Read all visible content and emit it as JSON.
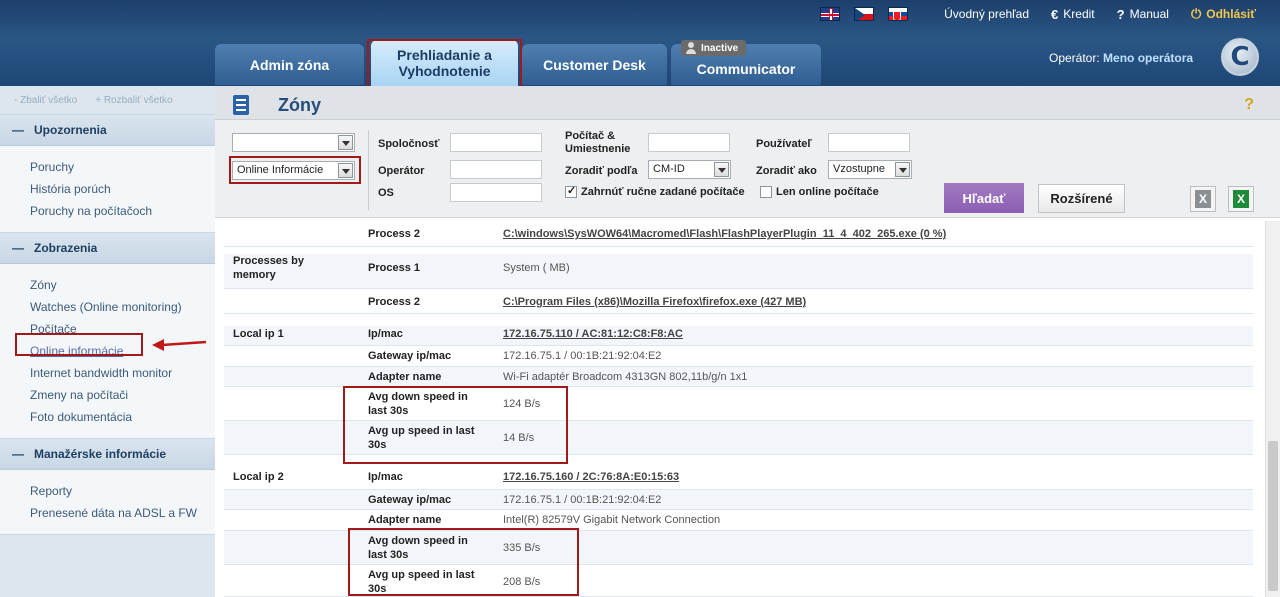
{
  "header": {
    "languages": [
      "en",
      "cz",
      "sk"
    ],
    "links": {
      "overview": "Úvodný prehľad",
      "credit": "Kredit",
      "manual": "Manual",
      "logout": "Odhlásiť"
    },
    "icons": {
      "credit": "euro-icon",
      "manual": "question-icon",
      "logout": "power-icon"
    },
    "tabs": [
      {
        "label": "Admin zóna"
      },
      {
        "label": "Prehliadanie a Vyhodnotenie",
        "active": true
      },
      {
        "label": "Customer Desk"
      },
      {
        "label": "Communicator",
        "badge": "Inactive"
      }
    ],
    "operator_label": "Operátor:",
    "operator_name": "Meno operátora",
    "logo_letter": "C"
  },
  "sidebar": {
    "collapse_all": "- Zbaliť všetko",
    "expand_all": "+ Rozbaliť všetko",
    "sections": [
      {
        "title": "Upozornenia",
        "items": [
          "Poruchy",
          "História porúch",
          "Poruchy na počítačoch"
        ]
      },
      {
        "title": "Zobrazenia",
        "items": [
          "Zóny",
          "Watches (Online monitoring)",
          "Počítače",
          "Online informácie",
          "Internet bandwidth monitor",
          "Zmeny na počítači",
          "Foto dokumentácia"
        ]
      },
      {
        "title": "Manažérske informácie",
        "items": [
          "Reporty",
          "Prenesené dáta na ADSL a FW"
        ]
      }
    ],
    "current_item": "Online informácie"
  },
  "main": {
    "title": "Zóny",
    "help": "?"
  },
  "filter": {
    "select_top_value": "",
    "select_info_value": "Online Informácie",
    "company_label": "Spoločnosť",
    "operator_label": "Operátor",
    "os_label": "OS",
    "computer_label": "Počítač & Umiestnenie",
    "sort_by_label": "Zoradiť podľa",
    "sort_by_value": "CM-ID",
    "user_label": "Používateľ",
    "sort_as_label": "Zoradiť ako",
    "sort_as_value": "Vzostupne",
    "include_manual_label": "Zahrnúť ručne zadané počítače",
    "include_manual_checked": true,
    "online_only_label": "Len online počítače",
    "online_only_checked": false,
    "search_button": "Hľadať",
    "advanced_button": "Rozšírené"
  },
  "rows": [
    {
      "group": "",
      "key": "Process 2",
      "value": "C:\\windows\\SysWOW64\\Macromed\\Flash\\FlashPlayerPlugin_11_4_402_265.exe (0 %)",
      "link": true
    },
    {
      "group": "Processes by memory",
      "key": "Process 1",
      "value": "System ( MB)",
      "link": false
    },
    {
      "group": "",
      "key": "Process 2",
      "value": "C:\\Program Files (x86)\\Mozilla Firefox\\firefox.exe (427 MB)",
      "link": true
    },
    {
      "group": "Local ip 1",
      "key": "Ip/mac",
      "value": "172.16.75.110 / AC:81:12:C8:F8:AC",
      "link": true
    },
    {
      "group": "",
      "key": "Gateway ip/mac",
      "value": "172.16.75.1 / 00:1B:21:92:04:E2",
      "link": false
    },
    {
      "group": "",
      "key": "Adapter name",
      "value": "Wi-Fi adaptér Broadcom 4313GN 802,11b/g/n 1x1",
      "link": false
    },
    {
      "group": "",
      "key": "Avg down speed in last 30s",
      "value": "124 B/s",
      "link": false
    },
    {
      "group": "",
      "key": "Avg up speed in last 30s",
      "value": "14 B/s",
      "link": false
    },
    {
      "group": "Local ip 2",
      "key": "Ip/mac",
      "value": "172.16.75.160 / 2C:76:8A:E0:15:63",
      "link": true
    },
    {
      "group": "",
      "key": "Gateway ip/mac",
      "value": "172.16.75.1 / 00:1B:21:92:04:E2",
      "link": false
    },
    {
      "group": "",
      "key": "Adapter name",
      "value": "Intel(R) 82579V Gigabit Network Connection",
      "link": false
    },
    {
      "group": "",
      "key": "Avg down speed in last 30s",
      "value": "335 B/s",
      "link": false
    },
    {
      "group": "",
      "key": "Avg up speed in last 30s",
      "value": "208 B/s",
      "link": false
    }
  ],
  "colors": {
    "header_bg": "#1e4676",
    "active_tab": "#a9d4f3",
    "search_button": "#8b5eb3",
    "highlight_box": "#a01a1a"
  }
}
